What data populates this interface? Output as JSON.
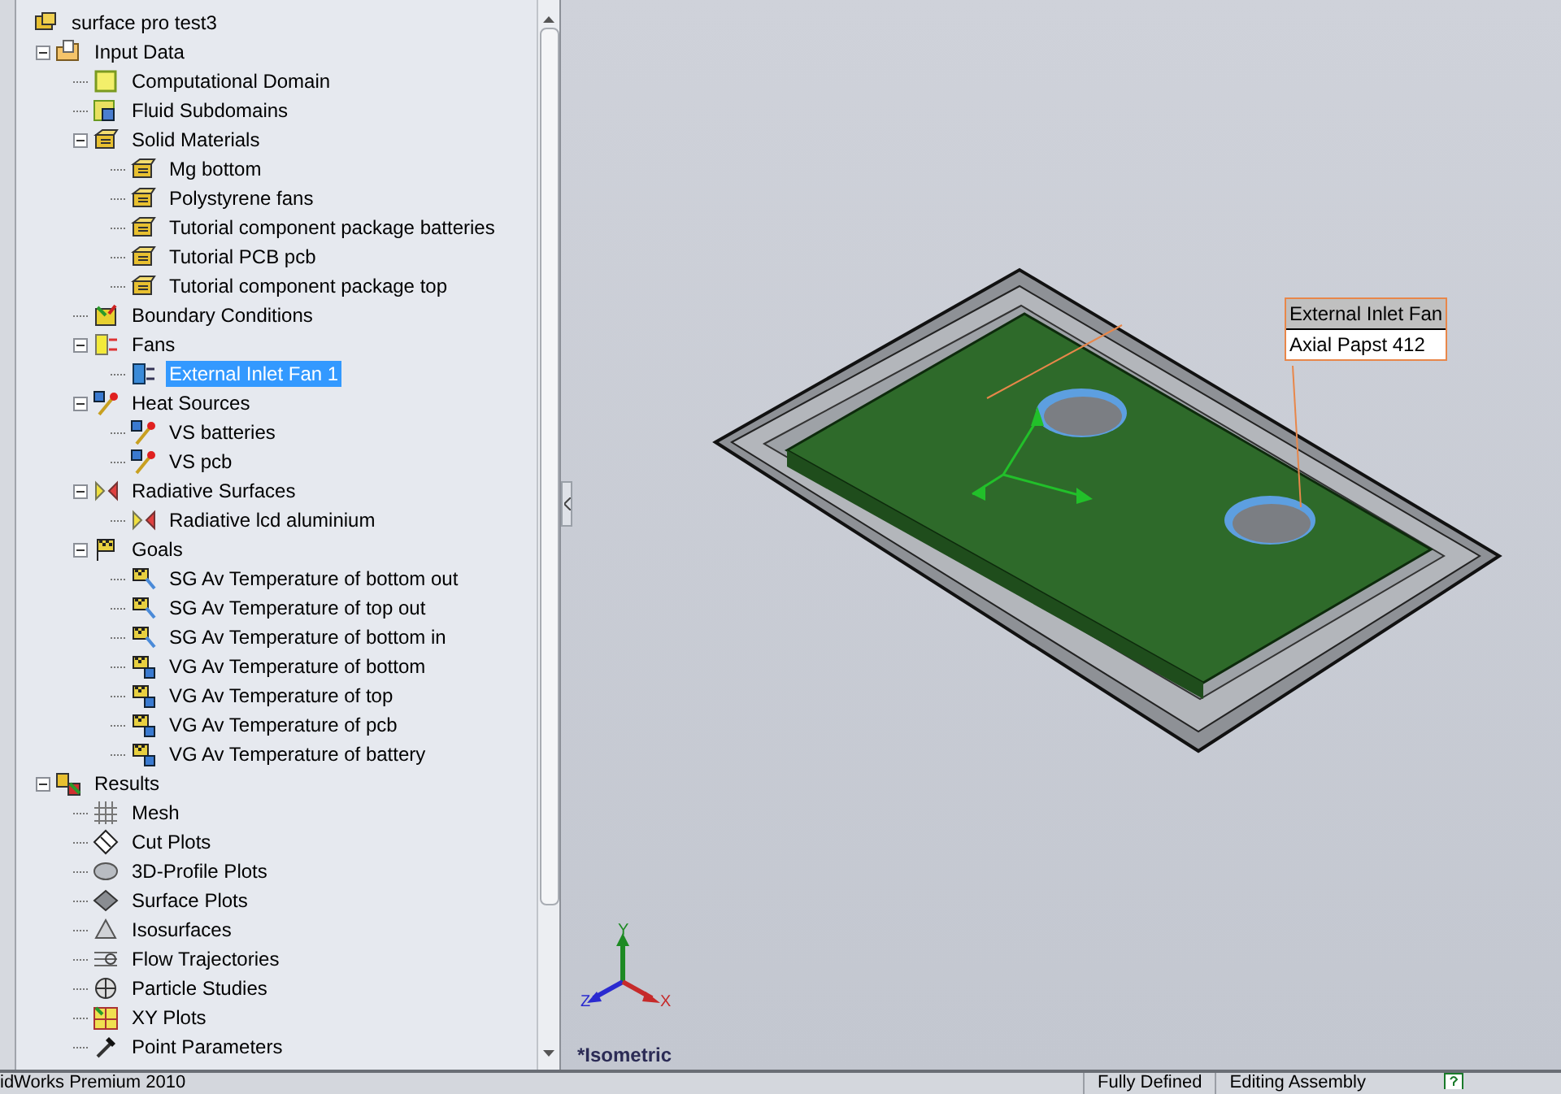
{
  "tree": {
    "label": "surface pro test3",
    "kind": "assembly",
    "children": [
      {
        "label": "Input Data",
        "kind": "folder",
        "expanded": true,
        "selected": false,
        "children": [
          {
            "label": "Computational Domain",
            "kind": "domain",
            "selected": false
          },
          {
            "label": "Fluid Subdomains",
            "kind": "subdomain",
            "selected": false
          },
          {
            "label": "Solid Materials",
            "kind": "material",
            "expanded": true,
            "selected": false,
            "children": [
              {
                "label": "Mg bottom",
                "kind": "material",
                "selected": false
              },
              {
                "label": "Polystyrene fans",
                "kind": "material",
                "selected": false
              },
              {
                "label": "Tutorial component package batteries",
                "kind": "material",
                "selected": false
              },
              {
                "label": "Tutorial PCB pcb",
                "kind": "material",
                "selected": false
              },
              {
                "label": "Tutorial component package top",
                "kind": "material",
                "selected": false
              }
            ]
          },
          {
            "label": "Boundary Conditions",
            "kind": "boundary",
            "selected": false
          },
          {
            "label": "Fans",
            "kind": "fan",
            "expanded": true,
            "selected": false,
            "children": [
              {
                "label": "External Inlet Fan 1",
                "kind": "fan-item",
                "selected": true
              }
            ]
          },
          {
            "label": "Heat Sources",
            "kind": "heat",
            "expanded": true,
            "selected": false,
            "children": [
              {
                "label": "VS batteries",
                "kind": "heat",
                "selected": false
              },
              {
                "label": "VS pcb",
                "kind": "heat",
                "selected": false
              }
            ]
          },
          {
            "label": "Radiative Surfaces",
            "kind": "radiative",
            "expanded": true,
            "selected": false,
            "children": [
              {
                "label": "Radiative lcd aluminium",
                "kind": "radiative",
                "selected": false
              }
            ]
          },
          {
            "label": "Goals",
            "kind": "goal",
            "expanded": true,
            "selected": false,
            "children": [
              {
                "label": "SG Av Temperature of bottom out",
                "kind": "goal-surface",
                "selected": false
              },
              {
                "label": "SG Av Temperature of top out",
                "kind": "goal-surface",
                "selected": false
              },
              {
                "label": "SG Av Temperature of bottom in",
                "kind": "goal-surface",
                "selected": false
              },
              {
                "label": "VG Av Temperature of bottom",
                "kind": "goal-volume",
                "selected": false
              },
              {
                "label": "VG Av Temperature of top",
                "kind": "goal-volume",
                "selected": false
              },
              {
                "label": "VG Av Temperature of pcb",
                "kind": "goal-volume",
                "selected": false
              },
              {
                "label": "VG Av Temperature of battery",
                "kind": "goal-volume",
                "selected": false
              }
            ]
          }
        ]
      },
      {
        "label": "Results",
        "kind": "results",
        "expanded": true,
        "selected": false,
        "children": [
          {
            "label": "Mesh",
            "kind": "mesh",
            "selected": false
          },
          {
            "label": "Cut Plots",
            "kind": "cut",
            "selected": false
          },
          {
            "label": "3D-Profile Plots",
            "kind": "profile",
            "selected": false
          },
          {
            "label": "Surface Plots",
            "kind": "surface",
            "selected": false
          },
          {
            "label": "Isosurfaces",
            "kind": "iso",
            "selected": false
          },
          {
            "label": "Flow Trajectories",
            "kind": "flow",
            "selected": false
          },
          {
            "label": "Particle Studies",
            "kind": "particle",
            "selected": false
          },
          {
            "label": "XY Plots",
            "kind": "xy",
            "selected": false
          },
          {
            "label": "Point Parameters",
            "kind": "point",
            "selected": false
          }
        ]
      }
    ]
  },
  "callout": {
    "title": "External Inlet Fan",
    "value": "Axial Papst 412"
  },
  "triad": {
    "x": "X",
    "y": "Y",
    "z": "Z"
  },
  "view_label": "*Isometric",
  "status_bar": {
    "app": "idWorks Premium 2010",
    "items": [
      "Fully Defined",
      "Editing Assembly"
    ]
  }
}
